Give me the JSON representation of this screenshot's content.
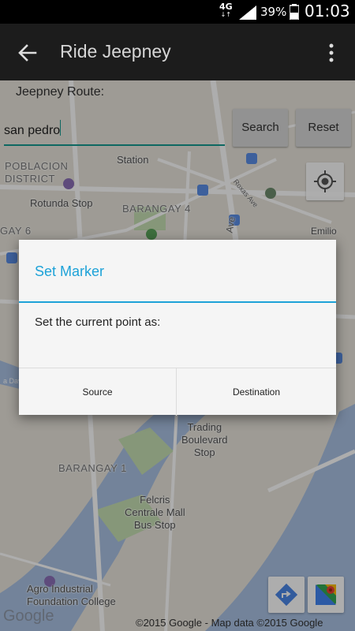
{
  "status_bar": {
    "network": "4G",
    "network_sub": "↓↑",
    "battery_percent": "39%",
    "time": "01:03"
  },
  "app_bar": {
    "title": "Ride Jeepney",
    "back_icon": "arrow-back-icon",
    "menu_icon": "overflow-menu-icon"
  },
  "route": {
    "label": "Jeepney Route:",
    "input_value": "san pedro",
    "search_label": "Search",
    "reset_label": "Reset"
  },
  "map": {
    "labels": {
      "station": "Station",
      "poblacion": "POBLACION\nDISTRICT",
      "rotunda": "Rotunda Stop",
      "barangay4": "BARANGAY 4",
      "roxas": "Roxas Ave",
      "ave": "Ave",
      "emilio": "Emilio\nPLES",
      "barangay6": "GAY 6",
      "davao": "a Dav",
      "trading": "Trading\nBoulevard\nStop",
      "barangay1": "BARANGAY 1",
      "felcris": "Felcris\nCentrale Mall\nBus Stop",
      "agro": "Agro Industrial\nFoundation College"
    },
    "google_logo": "Google",
    "copyright": "©2015 Google - Map data ©2015 Google",
    "colors": {
      "land": "#e9e5dc",
      "water": "#aac2e4",
      "park": "#c6dfb3",
      "road": "#ffffff"
    }
  },
  "dialog": {
    "title": "Set Marker",
    "message": "Set the current point as:",
    "source_label": "Source",
    "destination_label": "Destination",
    "accent_color": "#1da2d8"
  }
}
